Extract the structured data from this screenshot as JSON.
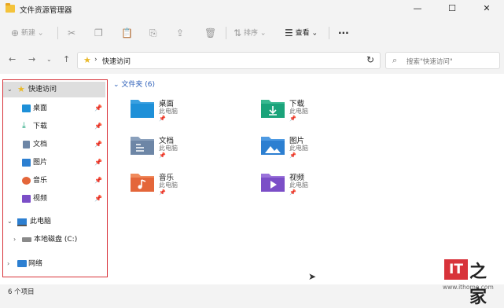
{
  "window": {
    "title": "文件资源管理器",
    "minimize": "—",
    "maximize": "☐",
    "close": "✕"
  },
  "toolbar": {
    "new_label": "新建",
    "sort_label": "排序",
    "view_label": "查看",
    "more_label": "···"
  },
  "address": {
    "path": "快速访问"
  },
  "search": {
    "placeholder": "搜索\"快速访问\""
  },
  "sidebar": {
    "quick_access": "快速访问",
    "items": [
      {
        "label": "桌面",
        "icon": "desktop-icon"
      },
      {
        "label": "下载",
        "icon": "download-icon"
      },
      {
        "label": "文档",
        "icon": "document-icon"
      },
      {
        "label": "图片",
        "icon": "pictures-icon"
      },
      {
        "label": "音乐",
        "icon": "music-icon"
      },
      {
        "label": "视频",
        "icon": "video-icon"
      }
    ],
    "this_pc": "此电脑",
    "local_disk": "本地磁盘 (C:)",
    "network": "网络"
  },
  "content": {
    "section_title": "文件夹 (6)",
    "folders": [
      {
        "name": "桌面",
        "location": "此电脑",
        "color": "#1e90d8"
      },
      {
        "name": "下载",
        "location": "此电脑",
        "color": "#1aa37a"
      },
      {
        "name": "文档",
        "location": "此电脑",
        "color": "#6d86a6"
      },
      {
        "name": "图片",
        "location": "此电脑",
        "color": "#2c7fd1"
      },
      {
        "name": "音乐",
        "location": "此电脑",
        "color": "#e4663a"
      },
      {
        "name": "视频",
        "location": "此电脑",
        "color": "#7b4ec7"
      }
    ]
  },
  "status": {
    "item_count": "6 个项目"
  },
  "watermark": {
    "it": "IT",
    "zh": "之家",
    "url": "www.ithome.com"
  },
  "colors": {
    "highlight_border": "#d8333a",
    "accent": "#2b5eb8"
  }
}
